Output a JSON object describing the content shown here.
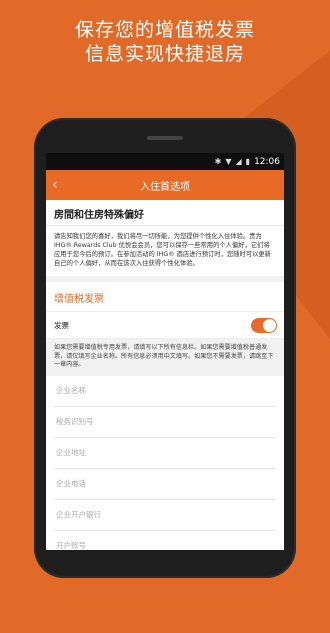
{
  "headline": {
    "line1": "保存您的增值税发票",
    "line2": "信息实现快捷退房"
  },
  "statusbar": {
    "time": "12:06"
  },
  "appbar": {
    "title": "入住首选项"
  },
  "preferences": {
    "section_title": "房間和住房特殊偏好",
    "intro_text": "请告知我们您的喜好，我们将尽一切所能，为您提供个性化入住体验。贵为 IHG® Rewards Club 优悦会会员，您可以保存一些常用的个人偏好，它们将应用于您今后的预订。在参加活动的 IHG® 酒店进行预订时，您随时可以更新自己的个人偏好，从而在该次入住获得个性化体验。"
  },
  "vat": {
    "title": "增值税发票",
    "invoice_label": "发票",
    "invoice_enabled": true,
    "note": "如果您需要增值税专用发票，请填写以下所有信息栏。如果您需要增值税普通发票，请仅填写企业名称。所有信息必须用中文填写。如果您不需要发票，请跳至下一章内容。",
    "fields": [
      {
        "placeholder": "企业名称"
      },
      {
        "placeholder": "税务识别号"
      },
      {
        "placeholder": "企业地址"
      },
      {
        "placeholder": "企业电话"
      },
      {
        "placeholder": "企业开户银行"
      },
      {
        "placeholder": "开户账号"
      }
    ]
  },
  "colors": {
    "accent": "#e86a26",
    "background": "#e26a28"
  }
}
